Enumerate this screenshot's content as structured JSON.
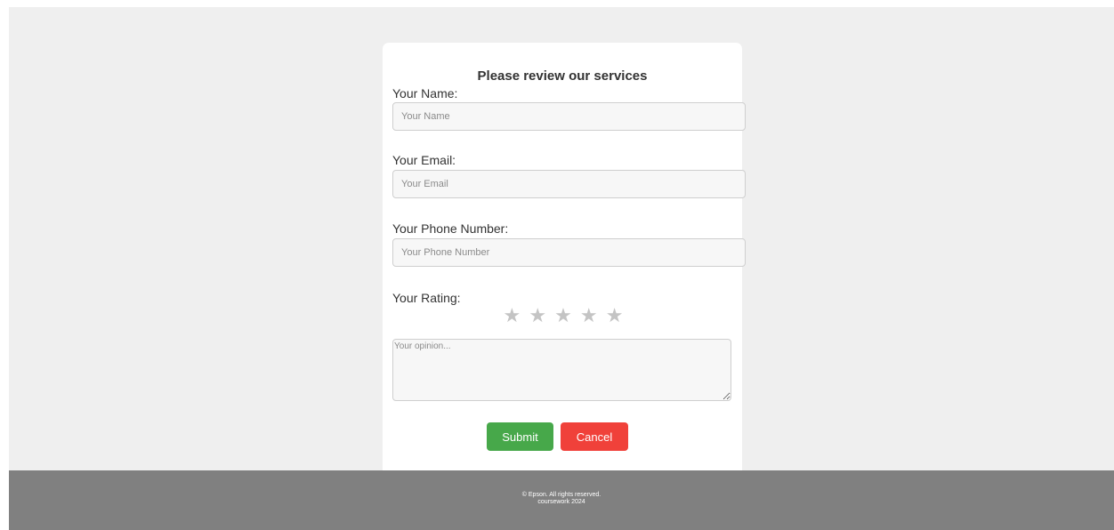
{
  "form": {
    "title": "Please review our services",
    "name_label": "Your Name:",
    "name_placeholder": "Your Name",
    "email_label": "Your Email:",
    "email_placeholder": "Your Email",
    "phone_label": "Your Phone Number:",
    "phone_placeholder": "Your Phone Number",
    "rating_label": "Your Rating:",
    "rating": {
      "value": 0,
      "max": 5,
      "glyph": "★",
      "empty_color": "#c4c4c4"
    },
    "opinion_placeholder": "Your opinion...",
    "submit_label": "Submit",
    "cancel_label": "Cancel"
  },
  "colors": {
    "submit": "#47a84a",
    "cancel": "#f0413a",
    "footer": "#808080",
    "page_background": "#efefef"
  },
  "footer": {
    "line1": "© Epson. All rights reserved.",
    "line2": "coursework 2024"
  }
}
